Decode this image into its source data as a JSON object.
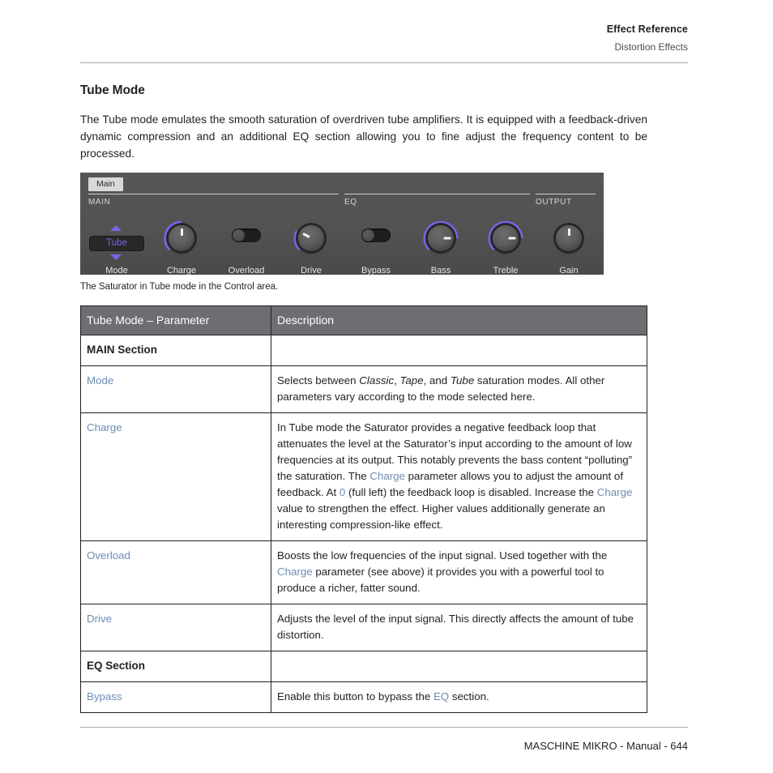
{
  "header": {
    "title": "Effect Reference",
    "subtitle": "Distortion Effects"
  },
  "page_title": "Tube Mode",
  "intro": "The Tube mode emulates the smooth saturation of overdriven tube amplifiers. It is equipped with a feedback-driven dynamic compression and an additional EQ section allowing you to fine adjust the frequency content to be processed.",
  "plugin": {
    "tab_label": "Main",
    "sections": {
      "main": "MAIN",
      "eq": "EQ",
      "output": "OUTPUT"
    },
    "controls": [
      {
        "name": "Mode",
        "type": "selector",
        "value": "Tube"
      },
      {
        "name": "Charge",
        "type": "knob",
        "indicator_deg": 0,
        "arc_start_deg": -135,
        "arc_end_deg": 0
      },
      {
        "name": "Overload",
        "type": "toggle",
        "value": "off"
      },
      {
        "name": "Drive",
        "type": "knob",
        "indicator_deg": -62,
        "arc_start_deg": -135,
        "arc_end_deg": -62
      },
      {
        "name": "Bypass",
        "type": "toggle",
        "value": "off"
      },
      {
        "name": "Bass",
        "type": "knob",
        "indicator_deg": 90,
        "arc_start_deg": -135,
        "arc_end_deg": 90
      },
      {
        "name": "Treble",
        "type": "knob",
        "indicator_deg": 90,
        "arc_start_deg": -135,
        "arc_end_deg": 90
      },
      {
        "name": "Gain",
        "type": "knob",
        "indicator_deg": 0,
        "arc_start_deg": 0,
        "arc_end_deg": 0
      }
    ],
    "accent_color": "#7b63e8",
    "panel_color": "#525252"
  },
  "caption": "The Saturator in Tube mode in the Control area.",
  "table": {
    "headers": [
      "Tube Mode – Parameter",
      "Description"
    ],
    "rows": [
      {
        "kind": "section",
        "param": "MAIN Section",
        "desc": ""
      },
      {
        "kind": "param",
        "param": "Mode",
        "desc_parts": [
          {
            "t": "Selects between "
          },
          {
            "t": "Classic",
            "s": "it"
          },
          {
            "t": ", "
          },
          {
            "t": "Tape",
            "s": "it"
          },
          {
            "t": ", and "
          },
          {
            "t": "Tube",
            "s": "it"
          },
          {
            "t": " saturation modes. All other parameters vary according to the mode selected here."
          }
        ]
      },
      {
        "kind": "param",
        "param": "Charge",
        "desc_parts": [
          {
            "t": "In Tube mode the Saturator provides a negative feedback loop that attenuates the level at the Saturator’s input according to the amount of low frequencies at its output. This notably prevents the bass content “polluting” the saturation. The "
          },
          {
            "t": "Charge",
            "s": "lnk"
          },
          {
            "t": " parameter allows you to adjust the amount of feedback. At "
          },
          {
            "t": "0",
            "s": "lnk"
          },
          {
            "t": " (full left) the feedback loop is disabled. Increase the "
          },
          {
            "t": "Charge",
            "s": "lnk"
          },
          {
            "t": " value to strengthen the effect. Higher values additionally generate an interesting compression-like effect."
          }
        ]
      },
      {
        "kind": "param",
        "param": "Overload",
        "desc_parts": [
          {
            "t": "Boosts the low frequencies of the input signal. Used together with the "
          },
          {
            "t": "Charge",
            "s": "lnk"
          },
          {
            "t": " parameter (see above) it provides you with a powerful tool to produce a richer, fatter sound."
          }
        ]
      },
      {
        "kind": "param",
        "param": "Drive",
        "desc_parts": [
          {
            "t": "Adjusts the level of the input signal. This directly affects the amount of tube distortion."
          }
        ]
      },
      {
        "kind": "section",
        "param": "EQ Section",
        "desc": ""
      },
      {
        "kind": "param",
        "param": "Bypass",
        "desc_parts": [
          {
            "t": "Enable this button to bypass the "
          },
          {
            "t": "EQ",
            "s": "lnk"
          },
          {
            "t": " section."
          }
        ]
      }
    ]
  },
  "footer": "MASCHINE MIKRO - Manual - 644"
}
